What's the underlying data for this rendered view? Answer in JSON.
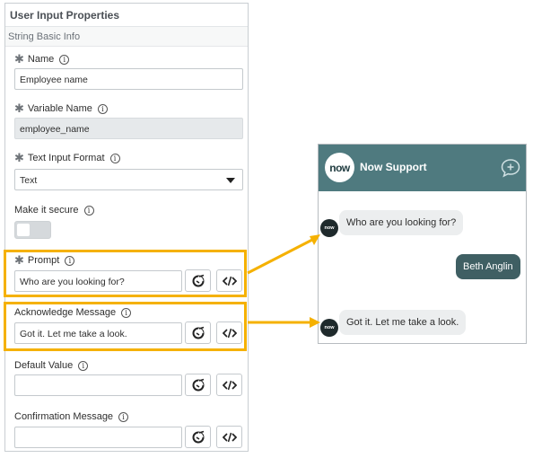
{
  "panel": {
    "title": "User Input Properties",
    "section": "String Basic Info"
  },
  "fields": {
    "name": {
      "label": "Name",
      "value": "Employee name",
      "required": true
    },
    "variable_name": {
      "label": "Variable Name",
      "value": "employee_name",
      "required": true
    },
    "text_input_format": {
      "label": "Text Input Format",
      "value": "Text",
      "required": true
    },
    "make_it_secure": {
      "label": "Make it secure",
      "toggle_on": false
    },
    "prompt": {
      "label": "Prompt",
      "value": "Who are you looking for?",
      "required": true
    },
    "acknowledge_message": {
      "label": "Acknowledge Message",
      "value": "Got it. Let me take a look."
    },
    "default_value": {
      "label": "Default Value",
      "value": ""
    },
    "confirmation_message": {
      "label": "Confirmation Message",
      "value": ""
    }
  },
  "icons": {
    "info": "info-icon",
    "data_pill": "data-pill-picker-icon",
    "script": "script-code-icon",
    "new_chat": "new-chat-icon"
  },
  "chat": {
    "logo_text": "now",
    "title": "Now Support",
    "messages": [
      {
        "from": "bot",
        "text": "Who are you looking for?"
      },
      {
        "from": "user",
        "text": "Beth Anglin"
      },
      {
        "from": "bot",
        "text": "Got it. Let me take a look."
      }
    ]
  },
  "colors": {
    "highlight": "#f5b100",
    "chat_header": "#4f7a7f",
    "user_bubble": "#3f5f63",
    "bot_bubble": "#eceeef"
  }
}
